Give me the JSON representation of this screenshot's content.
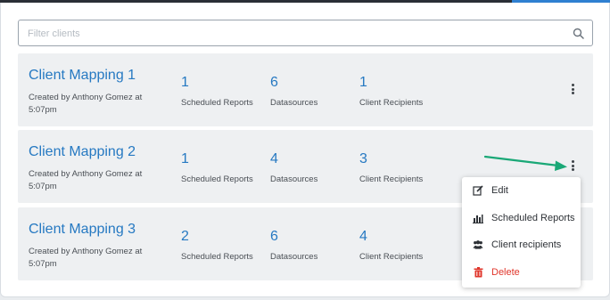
{
  "filter": {
    "placeholder": "Filter clients",
    "value": ""
  },
  "clients": [
    {
      "title": "Client Mapping 1",
      "subtitle": "Created by Anthony Gomez at 5:07pm",
      "scheduled_reports": "1",
      "datasources": "6",
      "client_recipients": "1"
    },
    {
      "title": "Client Mapping 2",
      "subtitle": "Created by Anthony Gomez at 5:07pm",
      "scheduled_reports": "1",
      "datasources": "4",
      "client_recipients": "3"
    },
    {
      "title": "Client Mapping 3",
      "subtitle": "Created by Anthony Gomez at 5:07pm",
      "scheduled_reports": "2",
      "datasources": "6",
      "client_recipients": "4"
    }
  ],
  "labels": {
    "scheduled_reports": "Scheduled Reports",
    "datasources": "Datasources",
    "client_recipients": "Client Recipients"
  },
  "context_menu": {
    "items": [
      {
        "label": "Edit",
        "icon": "edit-icon"
      },
      {
        "label": "Scheduled Reports",
        "icon": "bar-chart-icon"
      },
      {
        "label": "Client recipients",
        "icon": "users-icon"
      },
      {
        "label": "Delete",
        "icon": "trash-icon"
      }
    ]
  },
  "colors": {
    "accent": "#2679c2",
    "danger": "#e0362b",
    "arrow": "#1aa877",
    "card_bg": "#eef0f2"
  }
}
